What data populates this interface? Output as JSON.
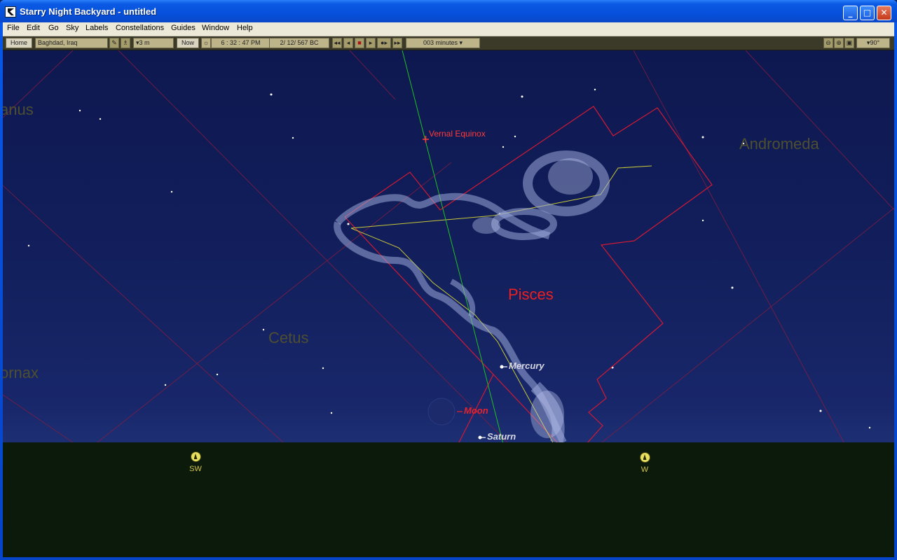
{
  "window": {
    "title": "Starry Night Backyard - untitled",
    "controls": {
      "minimize": "_",
      "maximize": "□",
      "close": "✕"
    }
  },
  "menu": [
    "File",
    "Edit",
    "Go",
    "Sky",
    "Labels",
    "Constellations",
    "Guides",
    "Window",
    "Help"
  ],
  "toolbar": {
    "home": "Home",
    "location": "Baghdad, Iraq",
    "elevation": "▾3 m",
    "now": "Now",
    "time": "6 : 32 : 47 PM",
    "date": "2/ 12/   567 BC",
    "time_step": "003 minutes ▾",
    "field_of_view": "▾90°"
  },
  "sky": {
    "constellations": [
      "anus",
      "Andromeda",
      "Cetus",
      "ornax"
    ],
    "highlighted_constellation": "Pisces",
    "vernal_equinox": "Vernal Equinox",
    "planets": {
      "mercury": "Mercury",
      "moon": "Moon",
      "saturn": "Saturn"
    },
    "compass": {
      "sw": "SW",
      "w": "W"
    }
  },
  "colors": {
    "sky_top": "#0e1850",
    "ground": "#0b1a0b",
    "constellation_boundary": "#c8183a",
    "ecliptic": "#c8c838",
    "equator_meridian": "#20c020",
    "pisces_label": "#ee1f1f",
    "compass": "#d6c44a"
  }
}
